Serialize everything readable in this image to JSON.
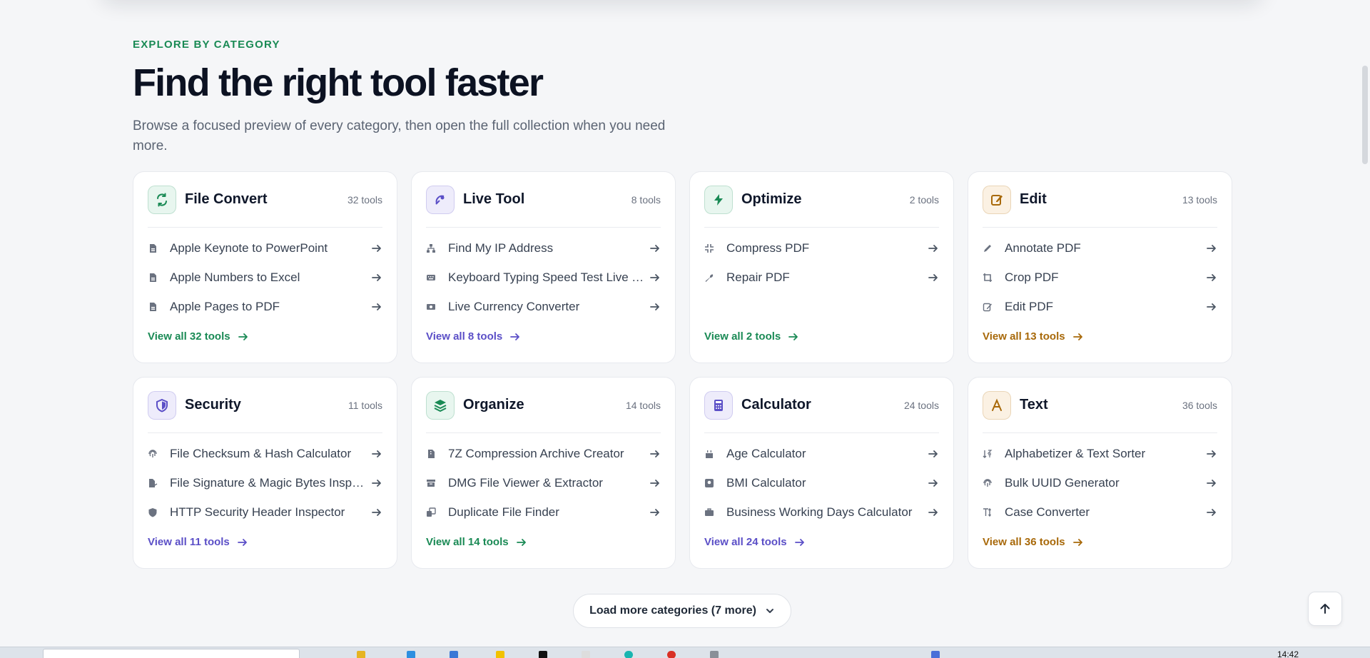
{
  "section": {
    "eyebrow": "EXPLORE BY CATEGORY",
    "headline": "Find the right tool faster",
    "lede": "Browse a focused preview of every category, then open the full collection when you need more."
  },
  "categories": [
    {
      "title": "File Convert",
      "count": "32 tools",
      "icon": "refresh-icon",
      "accent": "#1a8a55",
      "icon_bg": "#e8f6ef",
      "tools": [
        {
          "name": "Apple Keynote to PowerPoint",
          "icon": "file-icon"
        },
        {
          "name": "Apple Numbers to Excel",
          "icon": "file-icon"
        },
        {
          "name": "Apple Pages to PDF",
          "icon": "file-icon"
        }
      ],
      "view_all": "View all 32 tools"
    },
    {
      "title": "Live Tool",
      "count": "8 tools",
      "icon": "satellite-icon",
      "accent": "#5b4fc7",
      "icon_bg": "#eeecfb",
      "tools": [
        {
          "name": "Find My IP Address",
          "icon": "network-icon"
        },
        {
          "name": "Keyboard Typing Speed Test Live Test",
          "icon": "keyboard-icon"
        },
        {
          "name": "Live Currency Converter",
          "icon": "money-icon"
        }
      ],
      "view_all": "View all 8 tools"
    },
    {
      "title": "Optimize",
      "count": "2 tools",
      "icon": "bolt-icon",
      "accent": "#1a8a55",
      "icon_bg": "#e8f6ef",
      "tools": [
        {
          "name": "Compress PDF",
          "icon": "compress-icon"
        },
        {
          "name": "Repair PDF",
          "icon": "wrench-icon"
        }
      ],
      "view_all": "View all 2 tools"
    },
    {
      "title": "Edit",
      "count": "13 tools",
      "icon": "edit-icon",
      "accent": "#a8690a",
      "icon_bg": "#fbf1e3",
      "tools": [
        {
          "name": "Annotate PDF",
          "icon": "pen-icon"
        },
        {
          "name": "Crop PDF",
          "icon": "crop-icon"
        },
        {
          "name": "Edit PDF",
          "icon": "edit-icon"
        }
      ],
      "view_all": "View all 13 tools"
    },
    {
      "title": "Security",
      "count": "11 tools",
      "icon": "shield-icon",
      "accent": "#5b4fc7",
      "icon_bg": "#eeecfb",
      "tools": [
        {
          "name": "File Checksum & Hash Calculator",
          "icon": "fingerprint-icon"
        },
        {
          "name": "File Signature & Magic Bytes Inspector",
          "icon": "file-signature-icon"
        },
        {
          "name": "HTTP Security Header Inspector",
          "icon": "shield-icon"
        }
      ],
      "view_all": "View all 11 tools"
    },
    {
      "title": "Organize",
      "count": "14 tools",
      "icon": "layers-icon",
      "accent": "#1a8a55",
      "icon_bg": "#e8f6ef",
      "tools": [
        {
          "name": "7Z Compression Archive Creator",
          "icon": "file-zip-icon"
        },
        {
          "name": "DMG File Viewer & Extractor",
          "icon": "archive-icon"
        },
        {
          "name": "Duplicate File Finder",
          "icon": "copy-icon"
        }
      ],
      "view_all": "View all 14 tools"
    },
    {
      "title": "Calculator",
      "count": "24 tools",
      "icon": "calculator-icon",
      "accent": "#5b4fc7",
      "icon_bg": "#eeecfb",
      "tools": [
        {
          "name": "Age Calculator",
          "icon": "cake-icon"
        },
        {
          "name": "BMI Calculator",
          "icon": "scale-icon"
        },
        {
          "name": "Business Working Days Calculator",
          "icon": "briefcase-icon"
        }
      ],
      "view_all": "View all 24 tools"
    },
    {
      "title": "Text",
      "count": "36 tools",
      "icon": "font-icon",
      "accent": "#a8690a",
      "icon_bg": "#fbf1e3",
      "tools": [
        {
          "name": "Alphabetizer & Text Sorter",
          "icon": "sort-icon"
        },
        {
          "name": "Bulk UUID Generator",
          "icon": "fingerprint-icon"
        },
        {
          "name": "Case Converter",
          "icon": "text-height-icon"
        }
      ],
      "view_all": "View all 36 tools"
    }
  ],
  "load_more": "Load more categories (7 more)",
  "taskbar": {
    "clock": "14:42"
  }
}
